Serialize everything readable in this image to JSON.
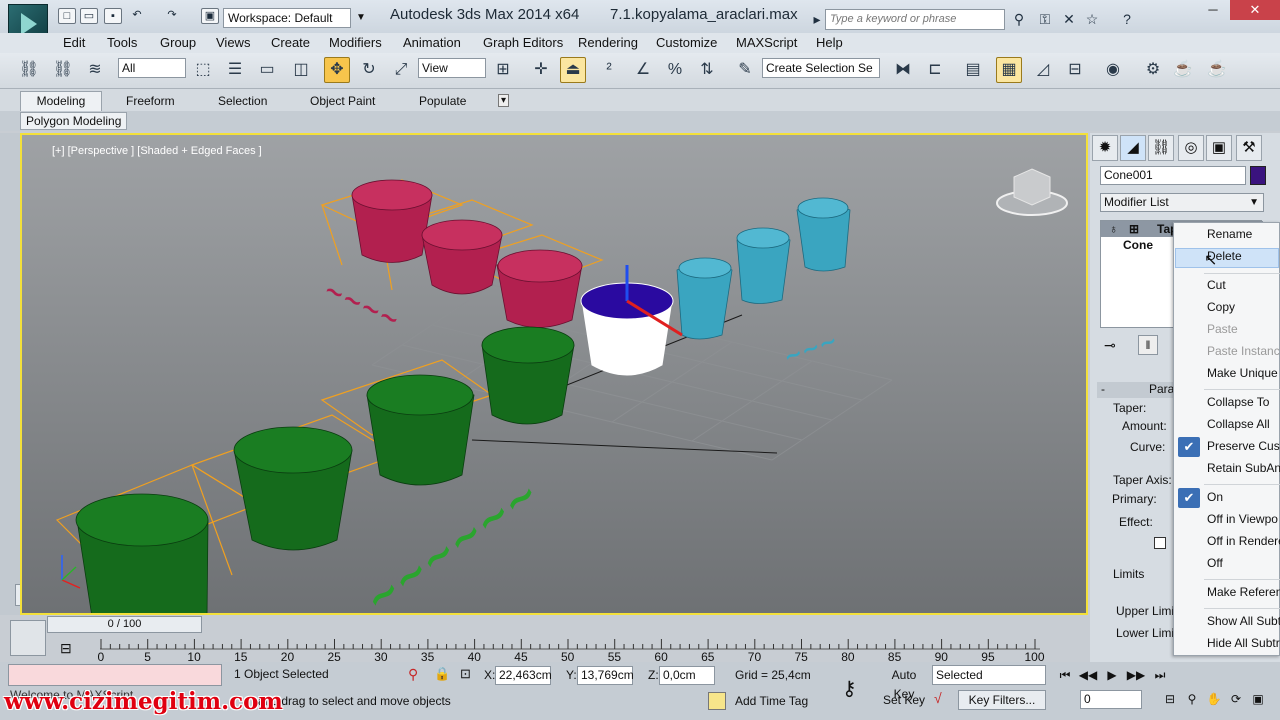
{
  "titlebar": {
    "workspace": "Workspace: Default",
    "app_title": "Autodesk 3ds Max  2014 x64",
    "file_title": "7.1.kopyalama_araclari.max",
    "search_placeholder": "Type a keyword or phrase"
  },
  "menubar": [
    "Edit",
    "Tools",
    "Group",
    "Views",
    "Create",
    "Modifiers",
    "Animation",
    "Graph Editors",
    "Rendering",
    "Customize",
    "MAXScript",
    "Help"
  ],
  "toolbar": {
    "selection_filter": "All",
    "reference_coord": "View",
    "named_selection": "Create Selection Se"
  },
  "ribbon": {
    "tabs": [
      "Modeling",
      "Freeform",
      "Selection",
      "Object Paint",
      "Populate"
    ],
    "active_tab": "Modeling",
    "panel": "Polygon Modeling"
  },
  "viewport": {
    "label": "[+] [Perspective ] [Shaded + Edged Faces ]"
  },
  "command_panel": {
    "object_name": "Cone001",
    "object_color": "#3a137e",
    "modifier_list": "Modifier List",
    "stack": [
      "Taper",
      "Cone"
    ],
    "rollout_title": "Para",
    "labels": {
      "taper": "Taper:",
      "amount": "Amount:",
      "curve": "Curve:",
      "taper_axis": "Taper Axis:",
      "primary": "Primary:",
      "effect": "Effect:",
      "limits": "Limits",
      "upper_limit": "Upper Limit",
      "lower_limit": "Lower Limit"
    }
  },
  "context_menu": {
    "items": [
      {
        "label": "Rename",
        "enabled": true
      },
      {
        "label": "Delete",
        "enabled": true,
        "highlighted": true
      },
      {
        "label": "Cut",
        "enabled": true
      },
      {
        "label": "Copy",
        "enabled": true
      },
      {
        "label": "Paste",
        "enabled": false
      },
      {
        "label": "Paste Instance",
        "enabled": false
      },
      {
        "label": "Make Unique",
        "enabled": true
      },
      {
        "label": "Collapse To",
        "enabled": true
      },
      {
        "label": "Collapse All",
        "enabled": true
      },
      {
        "label": "Preserve Custo",
        "enabled": true,
        "checked": true
      },
      {
        "label": "Retain SubAni",
        "enabled": true
      },
      {
        "label": "On",
        "enabled": true,
        "checked": true
      },
      {
        "label": "Off in Viewpo",
        "enabled": true
      },
      {
        "label": "Off in Rendere",
        "enabled": true
      },
      {
        "label": "Off",
        "enabled": true
      },
      {
        "label": "Make Referen",
        "enabled": true
      },
      {
        "label": "Show All Subt",
        "enabled": true
      },
      {
        "label": "Hide All Subtr",
        "enabled": true
      }
    ]
  },
  "timeline": {
    "slider": "0 / 100",
    "ticks": [
      "0",
      "5",
      "10",
      "15",
      "20",
      "25",
      "30",
      "35",
      "40",
      "45",
      "50",
      "55",
      "60",
      "65",
      "70",
      "75",
      "80",
      "85",
      "90",
      "95",
      "100"
    ]
  },
  "status": {
    "selection": "1 Object Selected",
    "hint": "and drag to select and move objects",
    "welcome": "Welcome to MAXScript.",
    "x_label": "X:",
    "x": "22,463cm",
    "y_label": "Y:",
    "y": "13,769cm",
    "z_label": "Z:",
    "z": "0,0cm",
    "grid": "Grid = 25,4cm",
    "add_time_tag": "Add Time Tag",
    "auto_key": "Auto Key",
    "auto_key_mode": "Selected",
    "set_key": "Set Key",
    "key_filters": "Key Filters...",
    "frame": "0"
  },
  "watermark": "www.cizimegitim.com"
}
